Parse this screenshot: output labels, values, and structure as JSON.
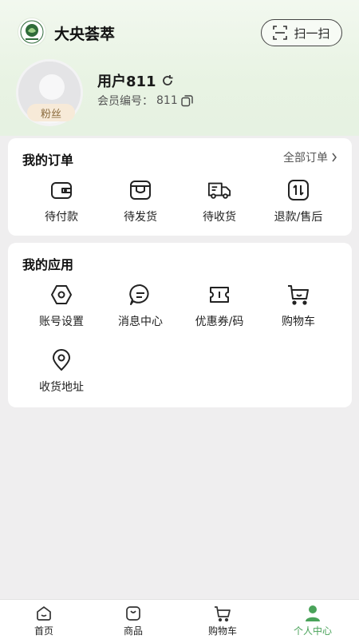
{
  "header": {
    "app_title": "大央荟萃",
    "scan_label": "扫一扫",
    "logo_icon": "brand-logo-icon",
    "scan_icon": "scan-icon"
  },
  "profile": {
    "username": "用户811",
    "badge": "粉丝",
    "member_label": "会员编号：",
    "member_number": "811",
    "refresh_icon": "refresh-icon",
    "copy_icon": "copy-icon"
  },
  "orders": {
    "title": "我的订单",
    "all_label": "全部订单",
    "items": [
      {
        "label": "待付款",
        "icon": "wallet-icon"
      },
      {
        "label": "待发货",
        "icon": "package-icon"
      },
      {
        "label": "待收货",
        "icon": "truck-icon"
      },
      {
        "label": "退款/售后",
        "icon": "refund-icon"
      }
    ]
  },
  "apps": {
    "title": "我的应用",
    "items": [
      {
        "label": "账号设置",
        "icon": "settings-icon"
      },
      {
        "label": "消息中心",
        "icon": "message-icon"
      },
      {
        "label": "优惠券/码",
        "icon": "coupon-icon"
      },
      {
        "label": "购物车",
        "icon": "cart-icon"
      },
      {
        "label": "收货地址",
        "icon": "location-icon"
      }
    ]
  },
  "bottom_nav": [
    {
      "label": "首页",
      "icon": "home-icon"
    },
    {
      "label": "商品",
      "icon": "bag-icon"
    },
    {
      "label": "购物车",
      "icon": "cart-icon"
    },
    {
      "label": "个人中心",
      "icon": "person-icon",
      "active": true
    }
  ],
  "colors": {
    "accent": "#4aa35a",
    "badge_bg": "#f7ead8",
    "header_bg": "#e8f3e3"
  }
}
